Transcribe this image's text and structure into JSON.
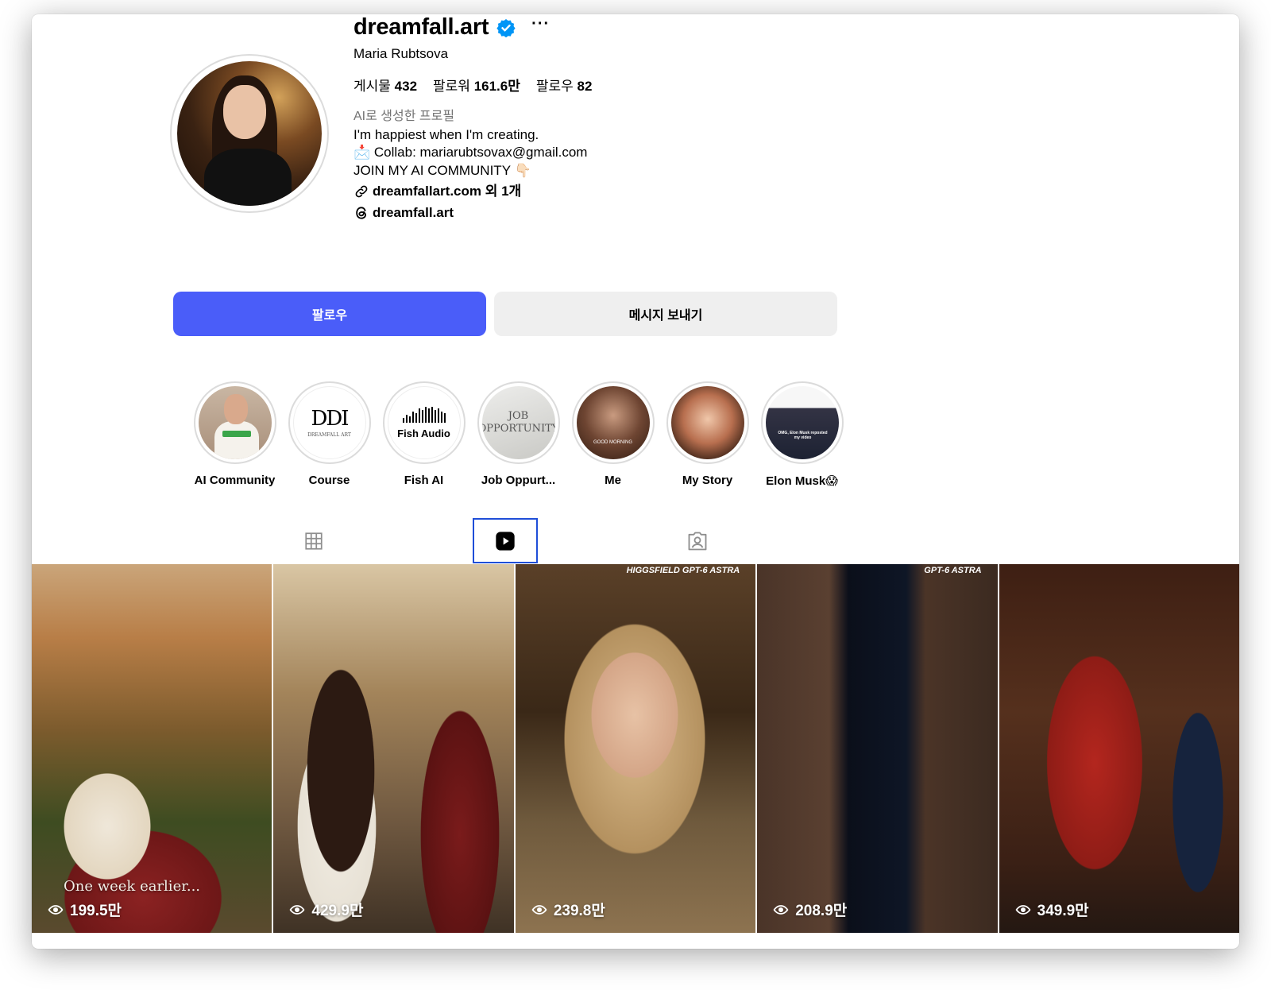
{
  "profile": {
    "username": "dreamfall.art",
    "more_label": "···",
    "full_name": "Maria Rubtsova",
    "stats": {
      "posts_label": "게시물",
      "posts_value": "432",
      "followers_label": "팔로워",
      "followers_value": "161.6만",
      "following_label": "팔로우",
      "following_value": "82"
    },
    "bio": {
      "ai_label": "AI로 생성한 프로필",
      "line1": "I'm happiest when I'm creating.",
      "line2": "📩 Collab: mariarubtsovax@gmail.com",
      "line3": "JOIN MY AI COMMUNITY 👇🏻",
      "link_text": "dreamfallart.com 외 1개",
      "threads_text": "dreamfall.art"
    }
  },
  "actions": {
    "follow_label": "팔로우",
    "message_label": "메시지 보내기"
  },
  "highlights": [
    {
      "label": "AI Community"
    },
    {
      "label": "Course",
      "logo_text": "DDI",
      "logo_sub": "DREAMFALL ART"
    },
    {
      "label": "Fish AI",
      "logo_text": "Fish Audio"
    },
    {
      "label": "Job Oppurt...",
      "image_text": "JOB OPPORTUNITY"
    },
    {
      "label": "Me",
      "image_text": "GOOD MORNING"
    },
    {
      "label": "My Story"
    },
    {
      "label": "Elon Musk😱",
      "image_text": "OMG, Elon Musk reposted my video"
    }
  ],
  "tabs": [
    {
      "name": "posts-grid",
      "icon": "grid-icon",
      "selected": false
    },
    {
      "name": "reels",
      "icon": "reels-icon",
      "selected": true
    },
    {
      "name": "tagged",
      "icon": "tagged-icon",
      "selected": false
    }
  ],
  "reels": [
    {
      "views": "199.5만",
      "caption": "One week earlier..."
    },
    {
      "views": "429.9만"
    },
    {
      "views": "239.8만",
      "tag": "HIGGSFIELD GPT-6 ASTRA"
    },
    {
      "views": "208.9만",
      "tag": "GPT-6 ASTRA"
    },
    {
      "views": "349.9만"
    }
  ],
  "colors": {
    "follow_button": "#4a5df9",
    "message_button": "#efefef",
    "verified_badge": "#0095f6",
    "selected_tab_border": "#1f4ed8"
  }
}
